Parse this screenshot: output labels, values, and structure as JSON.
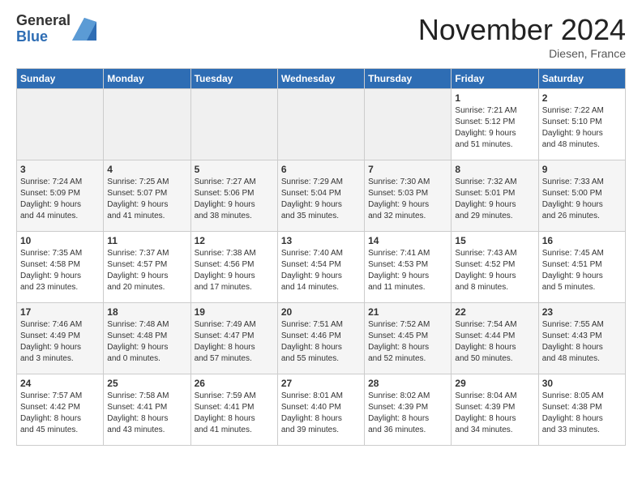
{
  "logo": {
    "general": "General",
    "blue": "Blue"
  },
  "header": {
    "month": "November 2024",
    "location": "Diesen, France"
  },
  "weekdays": [
    "Sunday",
    "Monday",
    "Tuesday",
    "Wednesday",
    "Thursday",
    "Friday",
    "Saturday"
  ],
  "weeks": [
    [
      {
        "day": "",
        "info": ""
      },
      {
        "day": "",
        "info": ""
      },
      {
        "day": "",
        "info": ""
      },
      {
        "day": "",
        "info": ""
      },
      {
        "day": "",
        "info": ""
      },
      {
        "day": "1",
        "info": "Sunrise: 7:21 AM\nSunset: 5:12 PM\nDaylight: 9 hours\nand 51 minutes."
      },
      {
        "day": "2",
        "info": "Sunrise: 7:22 AM\nSunset: 5:10 PM\nDaylight: 9 hours\nand 48 minutes."
      }
    ],
    [
      {
        "day": "3",
        "info": "Sunrise: 7:24 AM\nSunset: 5:09 PM\nDaylight: 9 hours\nand 44 minutes."
      },
      {
        "day": "4",
        "info": "Sunrise: 7:25 AM\nSunset: 5:07 PM\nDaylight: 9 hours\nand 41 minutes."
      },
      {
        "day": "5",
        "info": "Sunrise: 7:27 AM\nSunset: 5:06 PM\nDaylight: 9 hours\nand 38 minutes."
      },
      {
        "day": "6",
        "info": "Sunrise: 7:29 AM\nSunset: 5:04 PM\nDaylight: 9 hours\nand 35 minutes."
      },
      {
        "day": "7",
        "info": "Sunrise: 7:30 AM\nSunset: 5:03 PM\nDaylight: 9 hours\nand 32 minutes."
      },
      {
        "day": "8",
        "info": "Sunrise: 7:32 AM\nSunset: 5:01 PM\nDaylight: 9 hours\nand 29 minutes."
      },
      {
        "day": "9",
        "info": "Sunrise: 7:33 AM\nSunset: 5:00 PM\nDaylight: 9 hours\nand 26 minutes."
      }
    ],
    [
      {
        "day": "10",
        "info": "Sunrise: 7:35 AM\nSunset: 4:58 PM\nDaylight: 9 hours\nand 23 minutes."
      },
      {
        "day": "11",
        "info": "Sunrise: 7:37 AM\nSunset: 4:57 PM\nDaylight: 9 hours\nand 20 minutes."
      },
      {
        "day": "12",
        "info": "Sunrise: 7:38 AM\nSunset: 4:56 PM\nDaylight: 9 hours\nand 17 minutes."
      },
      {
        "day": "13",
        "info": "Sunrise: 7:40 AM\nSunset: 4:54 PM\nDaylight: 9 hours\nand 14 minutes."
      },
      {
        "day": "14",
        "info": "Sunrise: 7:41 AM\nSunset: 4:53 PM\nDaylight: 9 hours\nand 11 minutes."
      },
      {
        "day": "15",
        "info": "Sunrise: 7:43 AM\nSunset: 4:52 PM\nDaylight: 9 hours\nand 8 minutes."
      },
      {
        "day": "16",
        "info": "Sunrise: 7:45 AM\nSunset: 4:51 PM\nDaylight: 9 hours\nand 5 minutes."
      }
    ],
    [
      {
        "day": "17",
        "info": "Sunrise: 7:46 AM\nSunset: 4:49 PM\nDaylight: 9 hours\nand 3 minutes."
      },
      {
        "day": "18",
        "info": "Sunrise: 7:48 AM\nSunset: 4:48 PM\nDaylight: 9 hours\nand 0 minutes."
      },
      {
        "day": "19",
        "info": "Sunrise: 7:49 AM\nSunset: 4:47 PM\nDaylight: 8 hours\nand 57 minutes."
      },
      {
        "day": "20",
        "info": "Sunrise: 7:51 AM\nSunset: 4:46 PM\nDaylight: 8 hours\nand 55 minutes."
      },
      {
        "day": "21",
        "info": "Sunrise: 7:52 AM\nSunset: 4:45 PM\nDaylight: 8 hours\nand 52 minutes."
      },
      {
        "day": "22",
        "info": "Sunrise: 7:54 AM\nSunset: 4:44 PM\nDaylight: 8 hours\nand 50 minutes."
      },
      {
        "day": "23",
        "info": "Sunrise: 7:55 AM\nSunset: 4:43 PM\nDaylight: 8 hours\nand 48 minutes."
      }
    ],
    [
      {
        "day": "24",
        "info": "Sunrise: 7:57 AM\nSunset: 4:42 PM\nDaylight: 8 hours\nand 45 minutes."
      },
      {
        "day": "25",
        "info": "Sunrise: 7:58 AM\nSunset: 4:41 PM\nDaylight: 8 hours\nand 43 minutes."
      },
      {
        "day": "26",
        "info": "Sunrise: 7:59 AM\nSunset: 4:41 PM\nDaylight: 8 hours\nand 41 minutes."
      },
      {
        "day": "27",
        "info": "Sunrise: 8:01 AM\nSunset: 4:40 PM\nDaylight: 8 hours\nand 39 minutes."
      },
      {
        "day": "28",
        "info": "Sunrise: 8:02 AM\nSunset: 4:39 PM\nDaylight: 8 hours\nand 36 minutes."
      },
      {
        "day": "29",
        "info": "Sunrise: 8:04 AM\nSunset: 4:39 PM\nDaylight: 8 hours\nand 34 minutes."
      },
      {
        "day": "30",
        "info": "Sunrise: 8:05 AM\nSunset: 4:38 PM\nDaylight: 8 hours\nand 33 minutes."
      }
    ]
  ]
}
